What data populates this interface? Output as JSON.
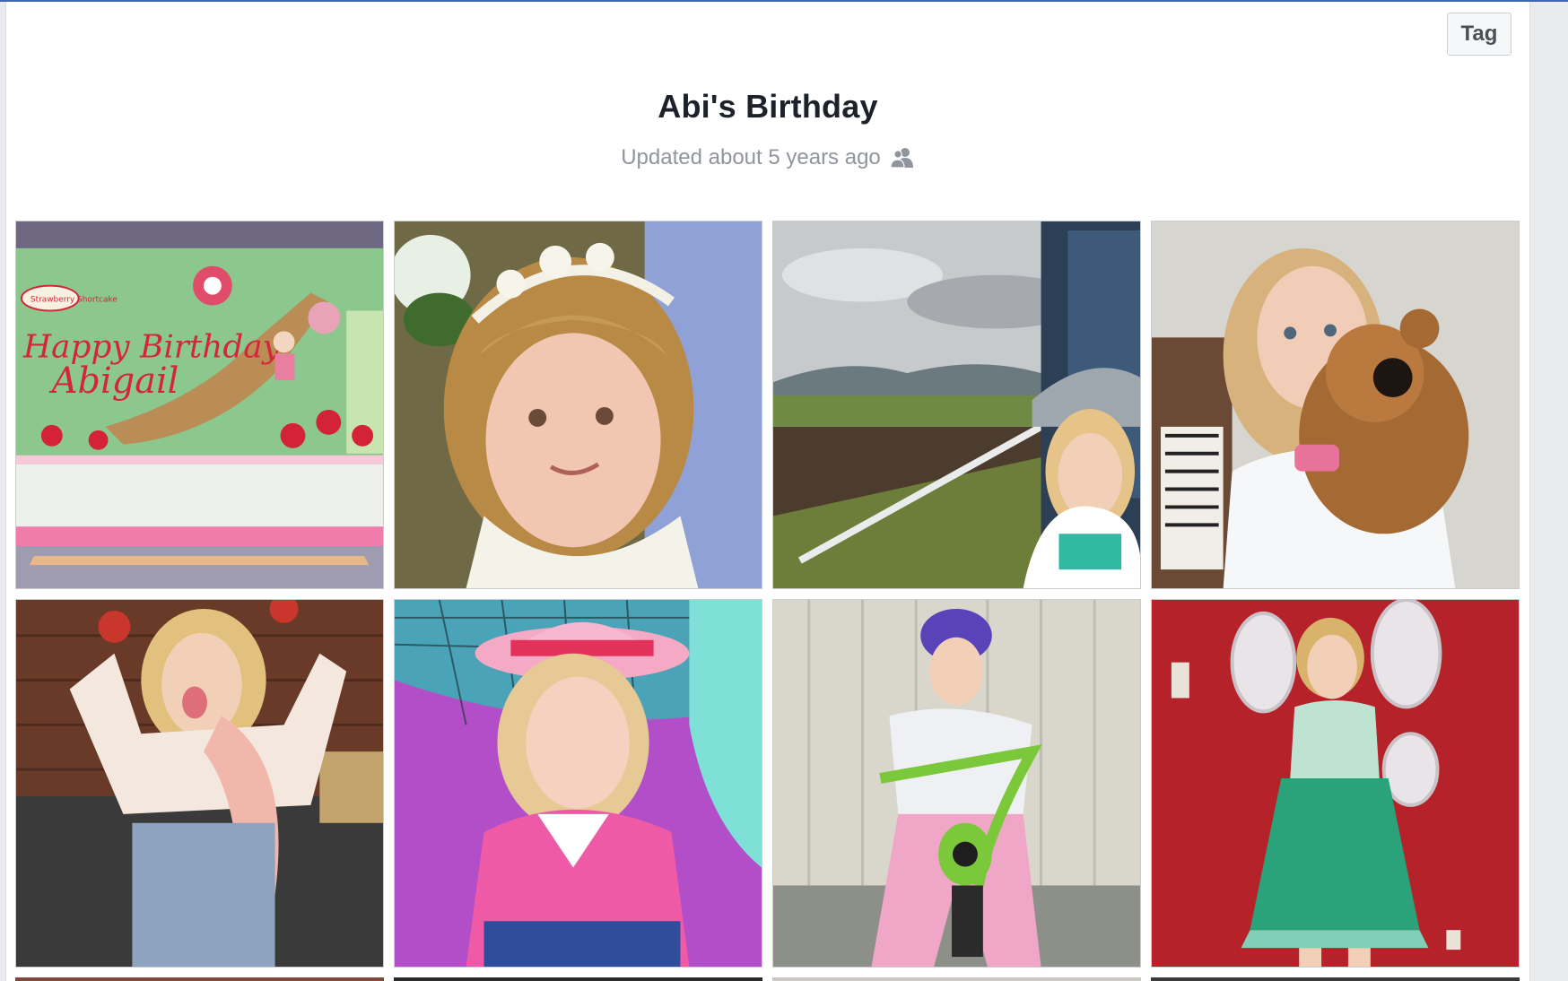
{
  "toolbar": {
    "tag_label": "Tag"
  },
  "album": {
    "title": "Abi's Birthday",
    "updated": "Updated about 5 years ago",
    "privacy_icon": "friends-icon"
  },
  "photos": [
    {
      "name": "photo-birthday-cake",
      "alt": "Birthday cake reading Happy Birthday Abigail",
      "cake_text_1": "Happy Birthday",
      "cake_text_2": "Abigail",
      "brand_text": "Strawberry Shortcake"
    },
    {
      "name": "photo-girl-headband",
      "alt": "Girl with flower headband"
    },
    {
      "name": "photo-girl-field",
      "alt": "Girl with cap in front of farm field"
    },
    {
      "name": "photo-girl-teddy",
      "alt": "Girl hugging teddy bear by piano"
    },
    {
      "name": "photo-girl-dancing",
      "alt": "Girl dancing with tongue out"
    },
    {
      "name": "photo-girl-pink-hat",
      "alt": "Girl in pink hat in bouncy castle"
    },
    {
      "name": "photo-girl-bike",
      "alt": "Girl on green bike with helmet"
    },
    {
      "name": "photo-girl-fairy",
      "alt": "Girl in fairy costume against red wall"
    }
  ],
  "colors": {
    "accent": "#4267b2",
    "title": "#1d2129",
    "meta": "#90949c"
  }
}
